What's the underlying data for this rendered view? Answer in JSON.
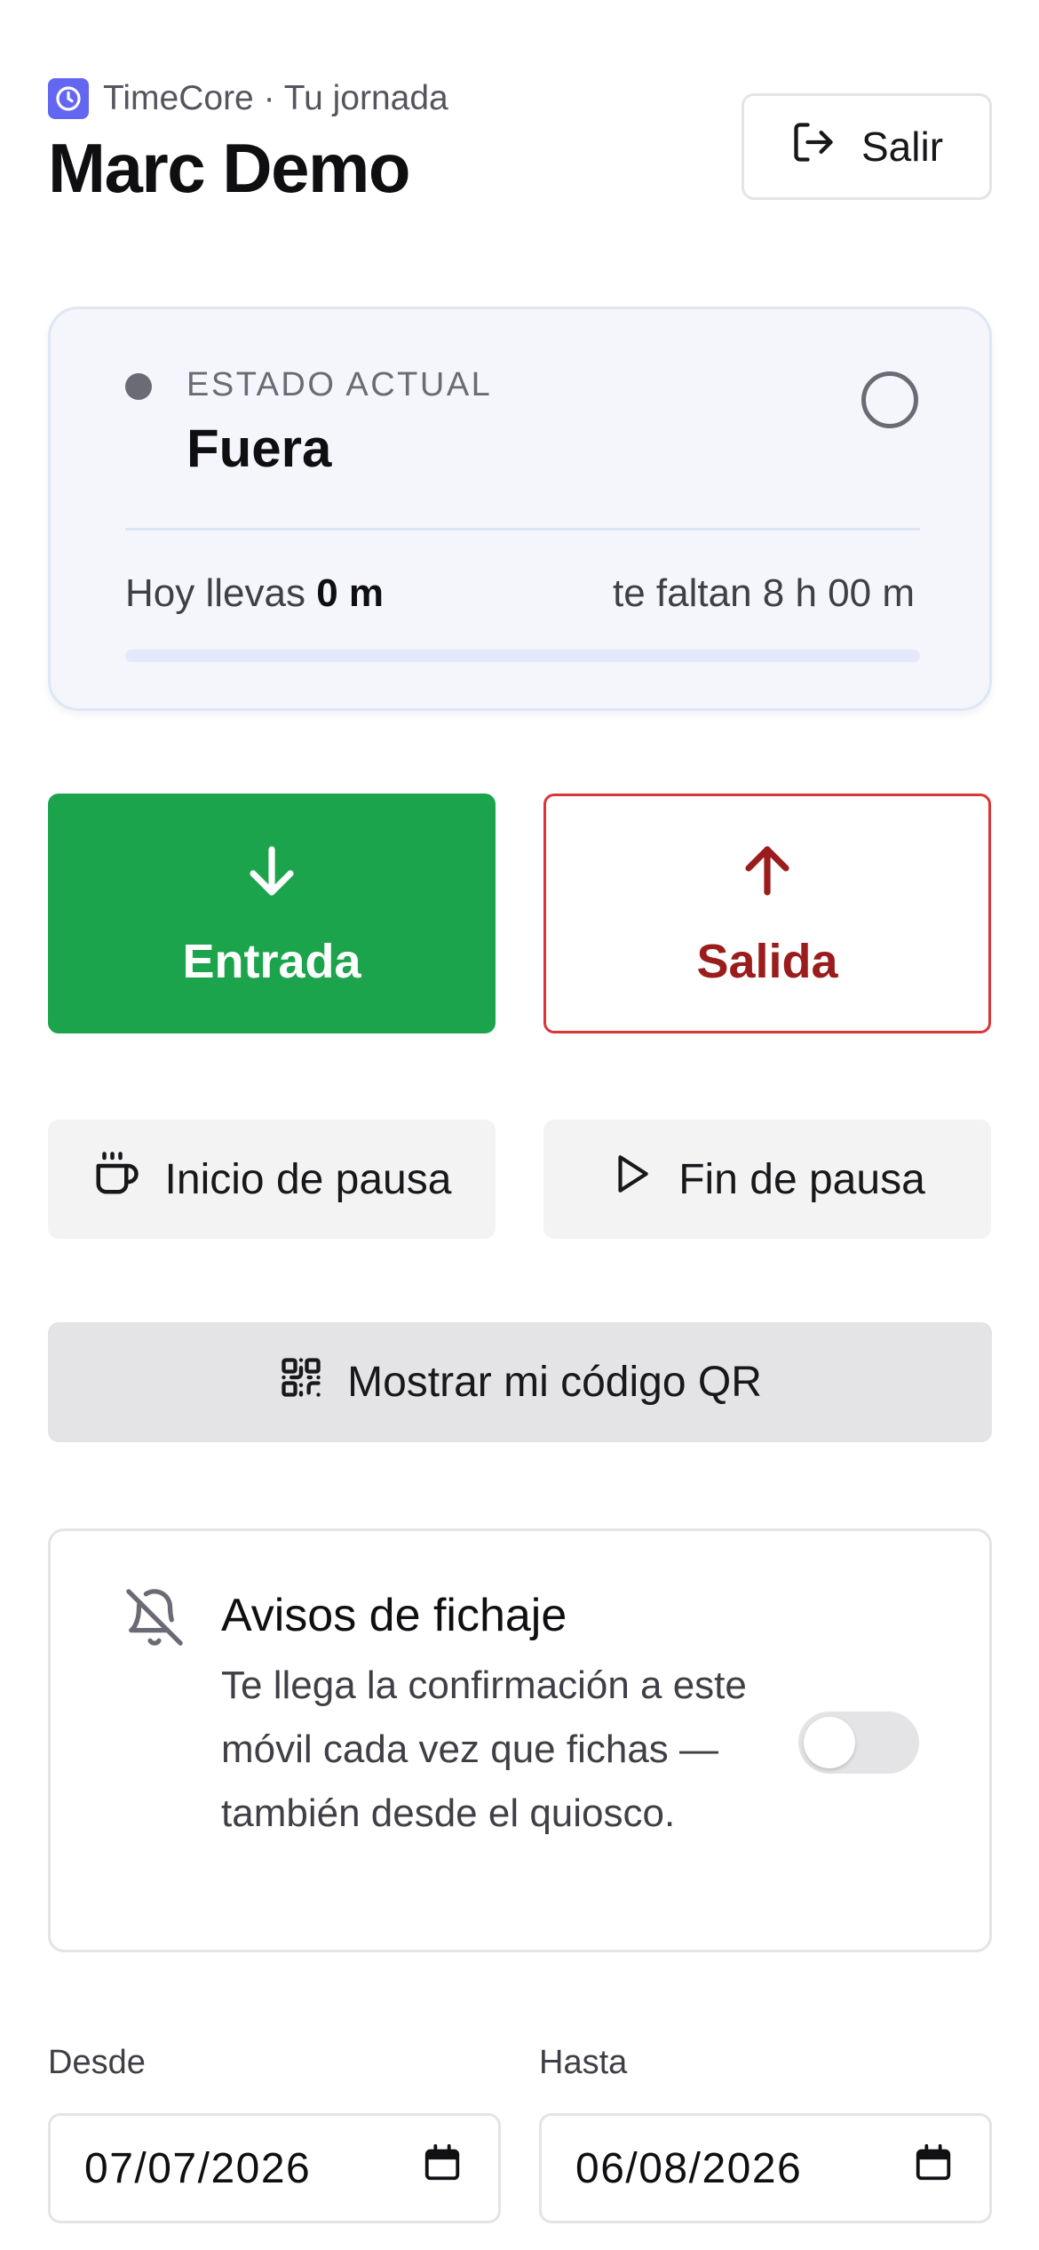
{
  "header": {
    "app_line": "TimeCore · Tu jornada",
    "user_name": "Marc Demo",
    "logout_label": "Salir"
  },
  "status": {
    "label": "ESTADO ACTUAL",
    "value": "Fuera",
    "worked_prefix": "Hoy llevas",
    "worked_value": "0 m",
    "remaining": "te faltan 8 h 00 m",
    "progress_fraction": 0
  },
  "actions": {
    "entrada_label": "Entrada",
    "salida_label": "Salida",
    "pause_start_label": "Inicio de pausa",
    "pause_end_label": "Fin de pausa",
    "qr_label": "Mostrar mi código QR"
  },
  "notifications": {
    "title": "Avisos de fichaje",
    "description": "Te llega la confirmación a este móvil cada vez que fichas — también desde el quiosco.",
    "enabled": false
  },
  "date_range": {
    "from_label": "Desde",
    "from_value": "07/07/2026",
    "to_label": "Hasta",
    "to_value": "06/08/2026"
  },
  "colors": {
    "accent": "#6366f1",
    "entrada": "#1ca44d",
    "salida": "#dc3535"
  },
  "icons": {
    "app": "clock-icon",
    "logout": "logout-icon",
    "entrada": "arrow-down-icon",
    "salida": "arrow-up-icon",
    "pause_start": "coffee-cup-icon",
    "pause_end": "play-icon",
    "qr": "qr-code-icon",
    "notifications": "bell-off-icon",
    "calendar": "calendar-icon"
  }
}
